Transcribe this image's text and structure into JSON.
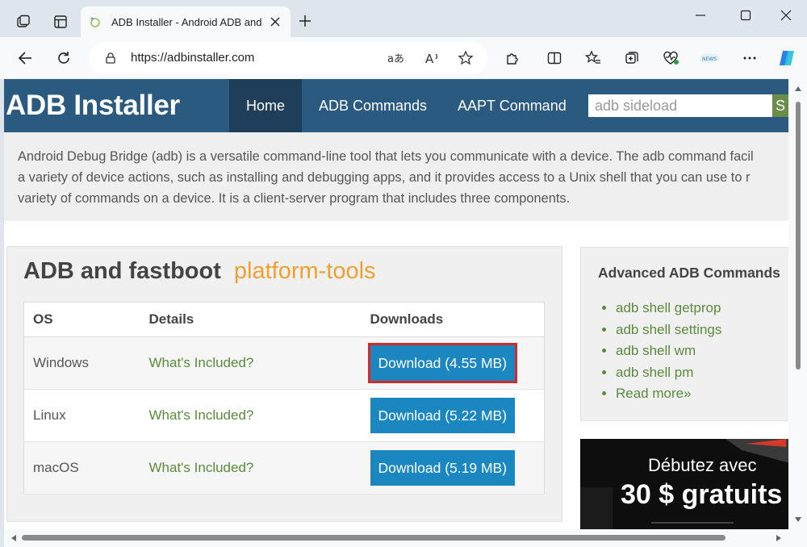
{
  "browser": {
    "tab_title": "ADB Installer - Android ADB and",
    "url": "https://adbinstaller.com",
    "icons": [
      "workspaces-icon",
      "tab-actions-icon",
      "new-tab-icon",
      "minimize-icon",
      "maximize-icon",
      "close-window-icon",
      "back-icon",
      "refresh-icon",
      "site-info-icon",
      "translate-icon",
      "read-aloud-icon",
      "favorite-star-icon",
      "extensions-icon",
      "split-screen-icon",
      "favorites-icon",
      "collections-icon",
      "browser-essentials-icon",
      "profile-icon",
      "more-icon",
      "copilot-icon"
    ]
  },
  "site": {
    "logo": "ADB Installer",
    "nav": [
      "Home",
      "ADB Commands",
      "AAPT Command"
    ],
    "search_placeholder": "adb sideload",
    "search_button": "S",
    "intro_lines": [
      "Android Debug Bridge (adb) is a versatile command-line tool that lets you communicate with a device. The adb command facil",
      "a variety of device actions, such as installing and debugging apps, and it provides access to a Unix shell that you can use to r",
      "variety of commands on a device. It is a client-server program that includes three components."
    ]
  },
  "main": {
    "title": "ADB and fastboot",
    "subtitle": "platform-tools",
    "table": {
      "headers": [
        "OS",
        "Details",
        "Downloads"
      ],
      "rows": [
        {
          "os": "Windows",
          "details": "What's Included?",
          "download": "Download (4.55 MB)"
        },
        {
          "os": "Linux",
          "details": "What's Included?",
          "download": "Download (5.22 MB)"
        },
        {
          "os": "macOS",
          "details": "What's Included?",
          "download": "Download (5.19 MB)"
        }
      ]
    }
  },
  "sidebar": {
    "title": "Advanced ADB Commands",
    "links": [
      "adb shell getprop",
      "adb shell settings",
      "adb shell wm",
      "adb shell pm",
      "Read more»"
    ]
  },
  "ad": {
    "line1": "Débutez avec",
    "line2": "30 $ gratuits"
  },
  "colors": {
    "header": "#2a5a80",
    "nav_active": "#1f3e59",
    "accent_orange": "#f0a030",
    "link_green": "#5a8a3c",
    "download_blue": "#1a87c0",
    "highlight_red": "#d42a2a"
  }
}
